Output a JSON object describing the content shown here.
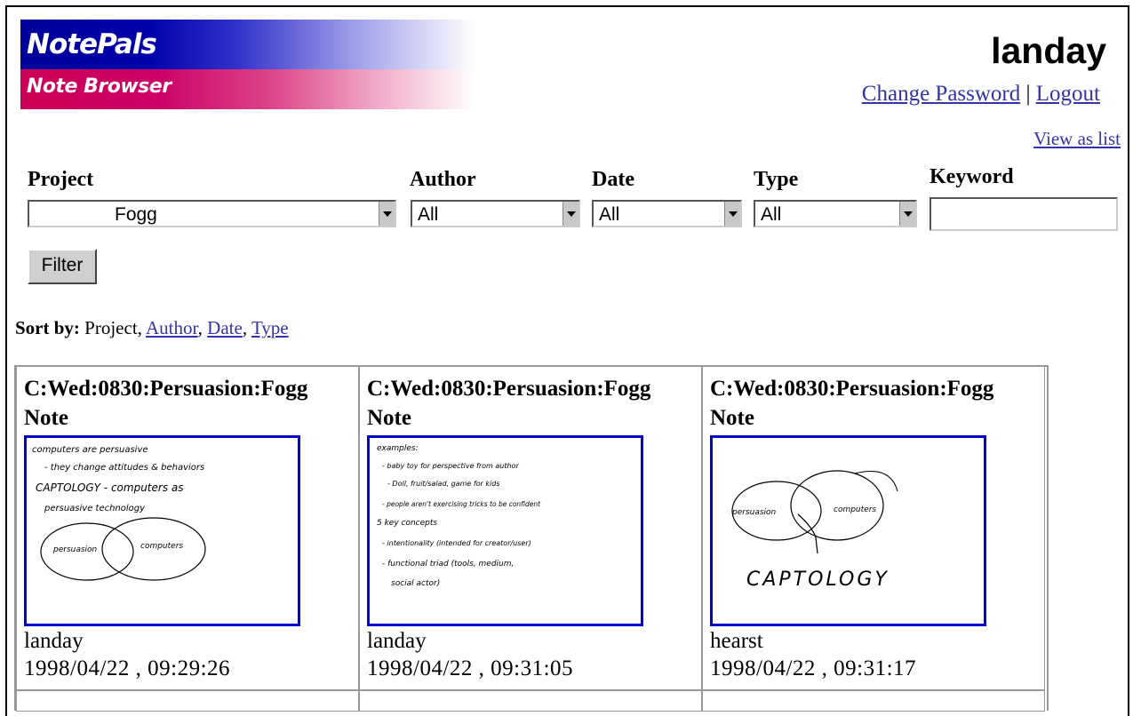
{
  "header": {
    "app_name": "NotePals",
    "subtitle": "Note Browser",
    "username": "landay",
    "change_password": "Change Password",
    "separator": "|",
    "logout": "Logout",
    "view_as_list": "View as list"
  },
  "filters": {
    "project": {
      "label": "Project",
      "value": "Fogg"
    },
    "author": {
      "label": "Author",
      "value": "All"
    },
    "date": {
      "label": "Date",
      "value": "All"
    },
    "type": {
      "label": "Type",
      "value": "All"
    },
    "keyword": {
      "label": "Keyword",
      "value": ""
    },
    "filter_button": "Filter"
  },
  "sort": {
    "label": "Sort by:",
    "current": "Project,",
    "author": "Author",
    "comma1": ",",
    "date": "Date",
    "comma2": ",",
    "type": "Type"
  },
  "notes": [
    {
      "title": "C:Wed:0830:Persuasion:Fogg",
      "type": "Note",
      "author": "landay",
      "timestamp": "1998/04/22 , 09:29:26",
      "sketch_text": [
        "computers are persuasive",
        "- they change attitudes & behaviors",
        "CAPTOLOGY - computers as",
        "persuasive technology",
        "persuasion",
        "computers"
      ]
    },
    {
      "title": "C:Wed:0830:Persuasion:Fogg",
      "type": "Note",
      "author": "landay",
      "timestamp": "1998/04/22 , 09:31:05",
      "sketch_text": [
        "examples:",
        "- baby toy for perspective from author",
        "- Doll, fruit/salad, game for kids",
        "- people aren't exercising tricks to be confident",
        "5 key concepts",
        "- intentionality (intended for creator/user)",
        "- functional triad (tools, medium,",
        "social actor)"
      ]
    },
    {
      "title": "C:Wed:0830:Persuasion:Fogg",
      "type": "Note",
      "author": "hearst",
      "timestamp": "1998/04/22 , 09:31:17",
      "sketch_text": [
        "persuasion",
        "computers",
        "CAPTOLOGY"
      ]
    }
  ]
}
